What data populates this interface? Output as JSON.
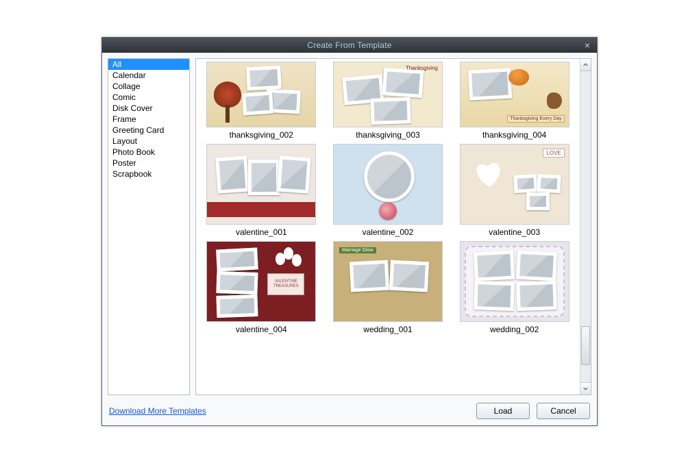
{
  "dialog": {
    "title": "Create From Template",
    "close_glyph": "×"
  },
  "sidebar": {
    "items": [
      {
        "label": "All",
        "selected": true
      },
      {
        "label": "Calendar"
      },
      {
        "label": "Collage"
      },
      {
        "label": "Comic"
      },
      {
        "label": "Disk Cover"
      },
      {
        "label": "Frame"
      },
      {
        "label": "Greeting Card"
      },
      {
        "label": "Layout"
      },
      {
        "label": "Photo Book"
      },
      {
        "label": "Poster"
      },
      {
        "label": "Scrapbook"
      }
    ]
  },
  "gallery": {
    "scroll": {
      "thumb_top_pct": 82,
      "thumb_height_pct": 12
    },
    "templates": [
      {
        "name": "thanksgiving_002",
        "kind": "t-thanks1"
      },
      {
        "name": "thanksgiving_003",
        "kind": "t-thanks2",
        "banner": "Thanksgiving"
      },
      {
        "name": "thanksgiving_004",
        "kind": "t-thanks3",
        "tag": "Thanksgiving Every Day"
      },
      {
        "name": "valentine_001",
        "kind": "t-val1"
      },
      {
        "name": "valentine_002",
        "kind": "t-val2"
      },
      {
        "name": "valentine_003",
        "kind": "t-val3",
        "love": "LOVE"
      },
      {
        "name": "valentine_004",
        "kind": "t-val4",
        "plaque": "VALENTINE TREASURES"
      },
      {
        "name": "wedding_001",
        "kind": "t-wed1",
        "ribbon": "Marriage Glow"
      },
      {
        "name": "wedding_002",
        "kind": "t-wed2"
      }
    ]
  },
  "footer": {
    "download_link": "Download More Templates",
    "load_label": "Load",
    "cancel_label": "Cancel"
  }
}
